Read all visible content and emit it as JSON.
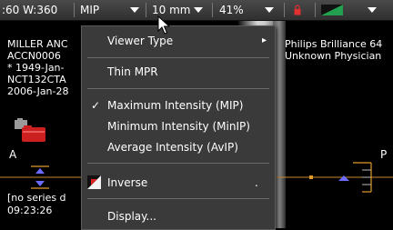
{
  "toolbar": {
    "window_width": ":60 W:360",
    "projection": "MIP",
    "slab": "10 mm",
    "zoom": "41%"
  },
  "overlay": {
    "patient_name": "MILLER ANC",
    "accession": "ACCN0006",
    "birth": "* 1949-Jan-",
    "study_id": "NCT132CTA",
    "study_date": "2006-Jan-28",
    "scanner": "Philips Brilliance 64",
    "physician": "Unknown Physician",
    "orient_left": "A",
    "orient_right": "P",
    "series_desc": "[no series d",
    "time": "09:23:26"
  },
  "menu": {
    "viewer_type": "Viewer Type",
    "thin_mpr": "Thin MPR",
    "mip": "Maximum Intensity (MIP)",
    "minip": "Minimum Intensity (MinIP)",
    "avip": "Average Intensity (AvIP)",
    "inverse": "Inverse",
    "inverse_shortcut": ".",
    "display": "Display...",
    "checkmark": "✓",
    "submenu_arrow": "▸"
  },
  "colors": {
    "toolbar": "#3c3c3c",
    "menu_bg": "#3a3a3a",
    "accent_orange": "#e39a2c",
    "lock_red": "#e03030"
  }
}
